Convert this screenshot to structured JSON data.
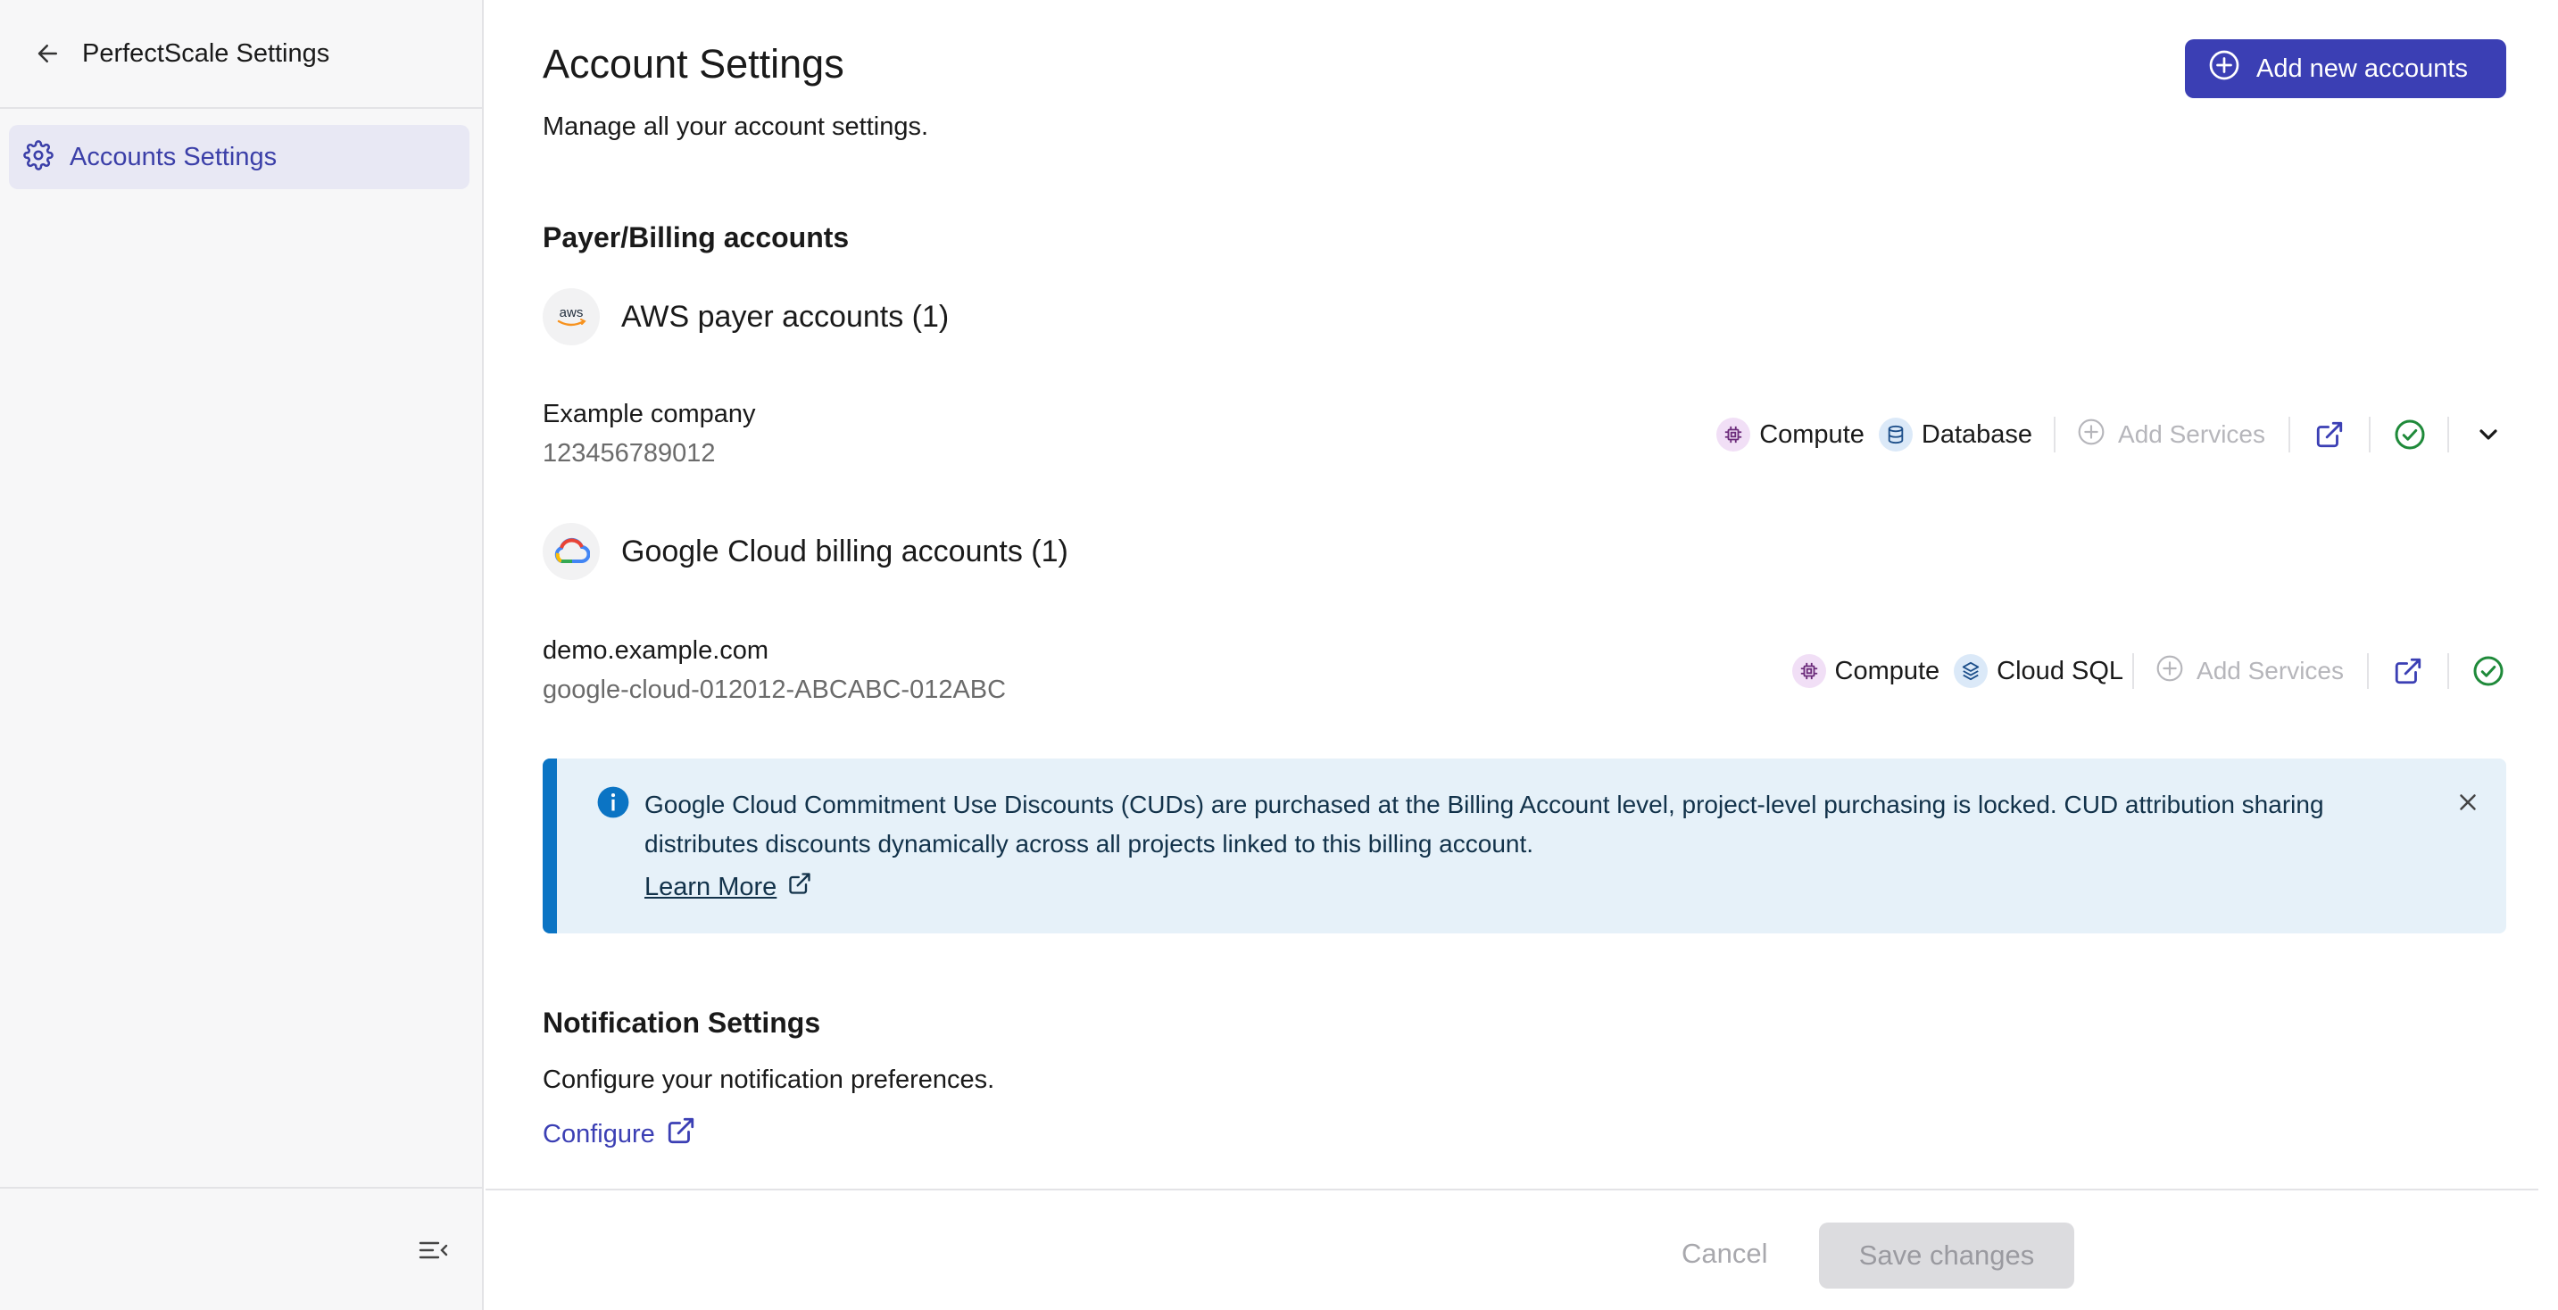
{
  "sidebar": {
    "title": "PerfectScale Settings",
    "items": [
      {
        "label": "Accounts Settings",
        "active": true
      }
    ]
  },
  "header": {
    "title": "Account Settings",
    "subtitle": "Manage all your account settings.",
    "add_button_label": "Add new accounts"
  },
  "billing": {
    "section_title": "Payer/Billing accounts",
    "providers": [
      {
        "name": "AWS payer accounts (1)",
        "logo": "aws-logo",
        "accounts": [
          {
            "name": "Example company",
            "id": "123456789012",
            "services": [
              "Compute",
              "Database"
            ],
            "add_services_label": "Add Services",
            "status": "connected"
          }
        ]
      },
      {
        "name": "Google Cloud billing accounts (1)",
        "logo": "google-cloud-logo",
        "accounts": [
          {
            "name": "demo.example.com",
            "id": "google-cloud-012012-ABCABC-012ABC",
            "services": [
              "Compute",
              "Cloud SQL"
            ],
            "add_services_label": "Add Services",
            "status": "connected"
          }
        ]
      }
    ]
  },
  "info_banner": {
    "text": "Google Cloud Commitment Use Discounts (CUDs) are purchased at the Billing Account level, project-level purchasing is locked. CUD attribution sharing distributes discounts dynamically across all projects linked to this billing account.",
    "link_label": "Learn More"
  },
  "notifications": {
    "title": "Notification Settings",
    "description": "Configure your notification preferences.",
    "link_label": "Configure"
  },
  "footer": {
    "cancel_label": "Cancel",
    "save_label": "Save changes"
  },
  "colors": {
    "accent": "#3b3fb4",
    "success": "#1f8a3a",
    "info": "#0b74c4"
  }
}
